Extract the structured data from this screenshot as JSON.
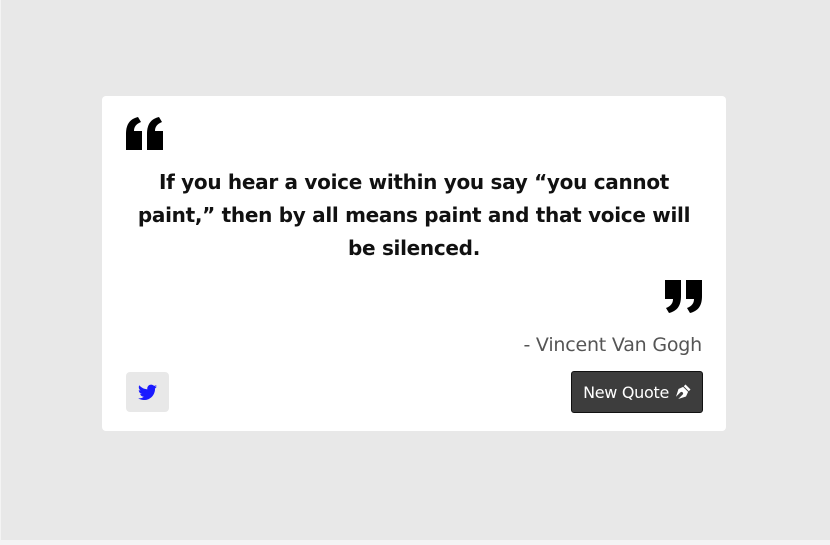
{
  "quote": {
    "text": "If you hear a voice within you say “you cannot paint,” then by all means paint and that voice will be silenced.",
    "author": "- Vincent Van Gogh"
  },
  "actions": {
    "tweet_icon": "twitter-icon",
    "new_quote_label": "New Quote",
    "new_quote_icon": "pen-nib-icon"
  },
  "colors": {
    "background": "#e8e8e8",
    "card": "#ffffff",
    "button_dark": "#3d3d3d",
    "twitter_blue": "#1a1aff"
  }
}
